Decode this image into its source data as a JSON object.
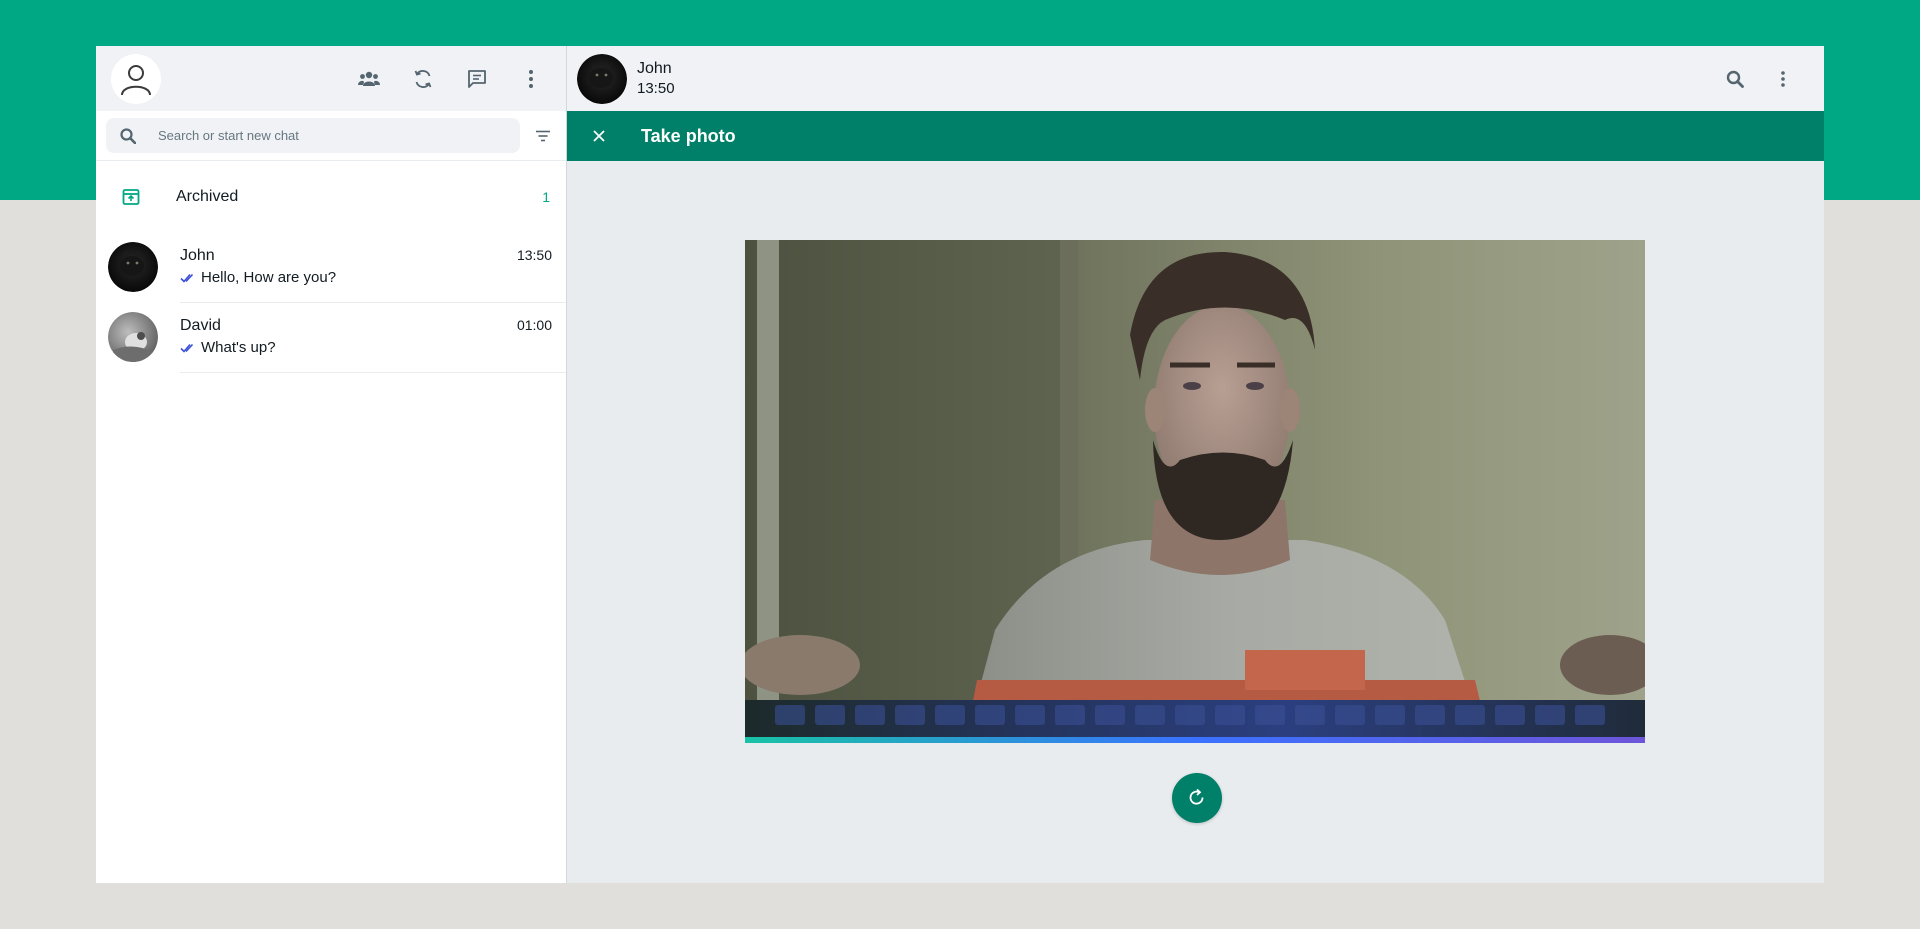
{
  "sidebar": {
    "header": {
      "avatar_icon": "user-silhouette-icon",
      "actions": [
        {
          "name": "communities-icon"
        },
        {
          "name": "status-icon"
        },
        {
          "name": "new-chat-icon"
        },
        {
          "name": "menu-icon"
        }
      ]
    },
    "search": {
      "placeholder": "Search or start new chat",
      "value": ""
    },
    "archived": {
      "label": "Archived",
      "count": "1"
    },
    "chats": [
      {
        "name": "John",
        "time": "13:50",
        "message": "Hello, How are you?",
        "read": true
      },
      {
        "name": "David",
        "time": "01:00",
        "message": "What's up?",
        "read": true
      }
    ]
  },
  "main": {
    "contact": {
      "name": "John",
      "status": "13:50"
    },
    "photo_panel": {
      "title": "Take photo"
    }
  },
  "colors": {
    "brand": "#00a884",
    "header_dark": "#008069",
    "read_tick": "#3b4fd8"
  }
}
